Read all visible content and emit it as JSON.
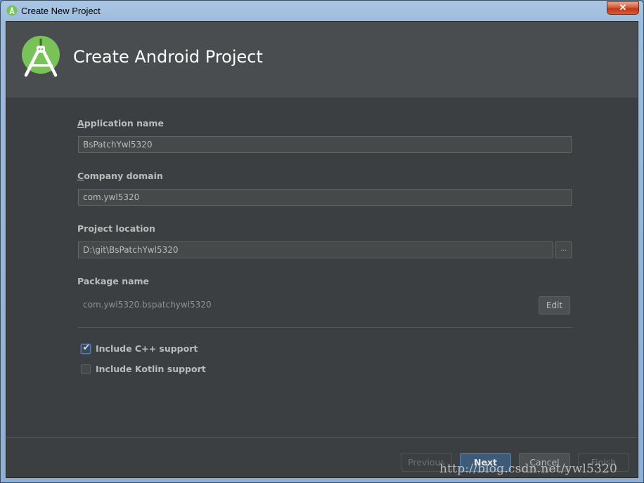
{
  "window": {
    "title": "Create New Project",
    "close_label": "✕"
  },
  "header": {
    "title": "Create Android Project"
  },
  "fields": {
    "app_name": {
      "label_accel": "A",
      "label_rest": "pplication name",
      "value": "BsPatchYwl5320"
    },
    "company_domain": {
      "label_accel": "C",
      "label_rest": "ompany domain",
      "value": "com.ywl5320"
    },
    "project_location": {
      "label": "Project location",
      "value": "D:\\git\\BsPatchYwl5320",
      "browse_label": "..."
    },
    "package_name": {
      "label": "Package name",
      "value": "com.ywl5320.bspatchywl5320",
      "edit_label": "Edit"
    }
  },
  "options": [
    {
      "label": "Include C++ support",
      "checked": true
    },
    {
      "label": "Include Kotlin support",
      "checked": false
    }
  ],
  "footer": {
    "previous": "Previous",
    "next": "Next",
    "cancel": "Cancel",
    "finish": "Finish"
  },
  "watermark": "http://blog.csdn.net/ywl5320",
  "colors": {
    "background": "#3c3f41",
    "header": "#4a4d4f",
    "android_green": "#78c257",
    "text": "#bbbbbb"
  },
  "icons": {
    "app": "android-studio-icon",
    "logo": "android-studio-logo",
    "check": "checkmark-icon"
  }
}
